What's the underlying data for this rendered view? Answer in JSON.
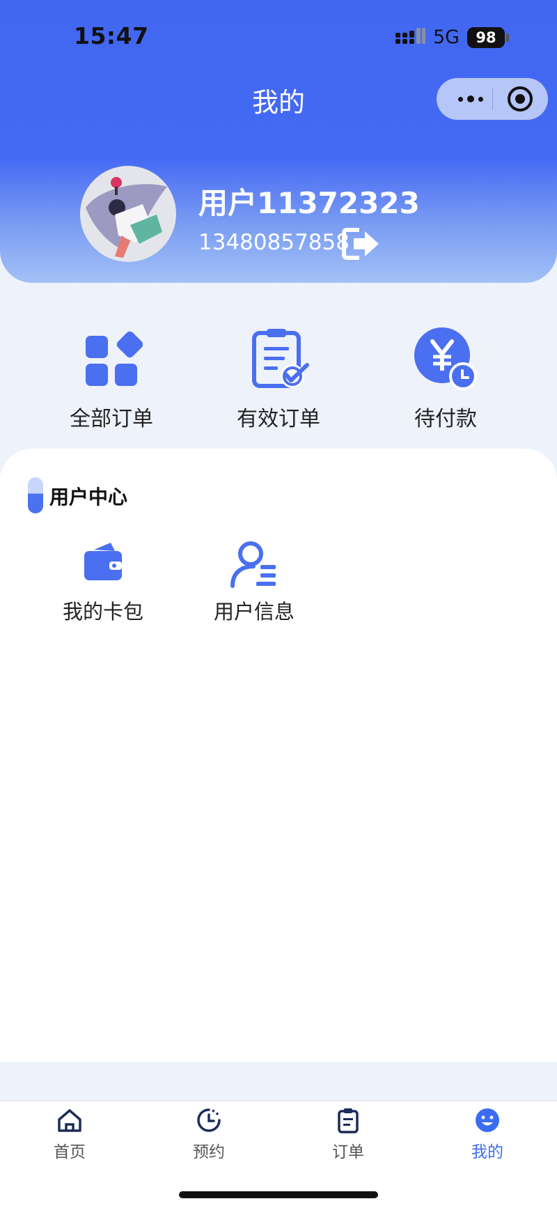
{
  "status_bar": {
    "time": "15:47",
    "network": "5G",
    "battery": "98"
  },
  "header": {
    "title": "我的"
  },
  "profile": {
    "username": "用户11372323",
    "phone": "13480857858"
  },
  "quick_actions": [
    {
      "label": "全部订单",
      "icon": "grid-icon"
    },
    {
      "label": "有效订单",
      "icon": "checklist-icon"
    },
    {
      "label": "待付款",
      "icon": "yen-clock-icon"
    }
  ],
  "user_center": {
    "title": "用户中心",
    "items": [
      {
        "label": "我的卡包",
        "icon": "wallet-icon"
      },
      {
        "label": "用户信息",
        "icon": "user-info-icon"
      }
    ]
  },
  "tabbar": {
    "items": [
      {
        "label": "首页",
        "icon": "home-icon"
      },
      {
        "label": "预约",
        "icon": "clock-icon"
      },
      {
        "label": "订单",
        "icon": "clipboard-icon"
      },
      {
        "label": "我的",
        "icon": "smiley-icon"
      }
    ],
    "active": "我的"
  },
  "colors": {
    "accent": "#3b6df0",
    "header_top": "#4167f2",
    "background": "#eef2fb"
  }
}
